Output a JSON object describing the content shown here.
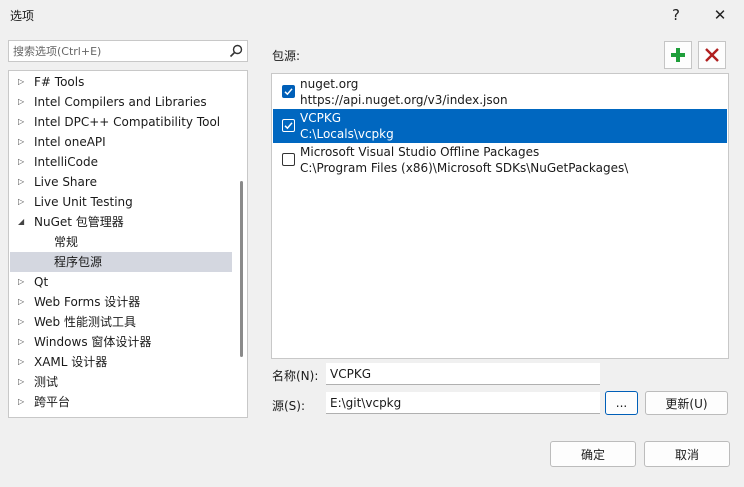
{
  "window": {
    "title": "选项",
    "help_glyph": "?",
    "close_glyph": "✕"
  },
  "search": {
    "placeholder": "搜索选项(Ctrl+E)"
  },
  "tree": {
    "items": [
      {
        "label": "F# Tools",
        "level": 0,
        "expanded": false
      },
      {
        "label": "Intel Compilers and Libraries",
        "level": 0,
        "expanded": false
      },
      {
        "label": "Intel DPC++ Compatibility Tool",
        "level": 0,
        "expanded": false
      },
      {
        "label": "Intel oneAPI",
        "level": 0,
        "expanded": false
      },
      {
        "label": "IntelliCode",
        "level": 0,
        "expanded": false
      },
      {
        "label": "Live Share",
        "level": 0,
        "expanded": false
      },
      {
        "label": "Live Unit Testing",
        "level": 0,
        "expanded": false
      },
      {
        "label": "NuGet 包管理器",
        "level": 0,
        "expanded": true
      },
      {
        "label": "常规",
        "level": 1
      },
      {
        "label": "程序包源",
        "level": 1,
        "selected": true
      },
      {
        "label": "Qt",
        "level": 0,
        "expanded": false
      },
      {
        "label": "Web Forms 设计器",
        "level": 0,
        "expanded": false
      },
      {
        "label": "Web 性能测试工具",
        "level": 0,
        "expanded": false
      },
      {
        "label": "Windows 窗体设计器",
        "level": 0,
        "expanded": false
      },
      {
        "label": "XAML 设计器",
        "level": 0,
        "expanded": false
      },
      {
        "label": "测试",
        "level": 0,
        "expanded": false
      },
      {
        "label": "跨平台",
        "level": 0,
        "expanded": false
      }
    ]
  },
  "sources": {
    "label": "包源:",
    "items": [
      {
        "name": "nuget.org",
        "url": "https://api.nuget.org/v3/index.json",
        "checked": true,
        "selected": false
      },
      {
        "name": "VCPKG",
        "url": "C:\\Locals\\vcpkg",
        "checked": true,
        "selected": true
      },
      {
        "name": "Microsoft Visual Studio Offline Packages",
        "url": "C:\\Program Files (x86)\\Microsoft SDKs\\NuGetPackages\\",
        "checked": false,
        "selected": false
      }
    ]
  },
  "form": {
    "name_label": "名称(N):",
    "name_value": "VCPKG",
    "source_label": "源(S):",
    "source_value": "E:\\git\\vcpkg",
    "browse_label": "...",
    "update_label": "更新(U)"
  },
  "footer": {
    "ok_label": "确定",
    "cancel_label": "取消"
  },
  "colors": {
    "accent": "#0067c0",
    "add_green": "#1e9e3a",
    "remove_red": "#b01e1e",
    "tree_selected": "#d4d7e0"
  }
}
